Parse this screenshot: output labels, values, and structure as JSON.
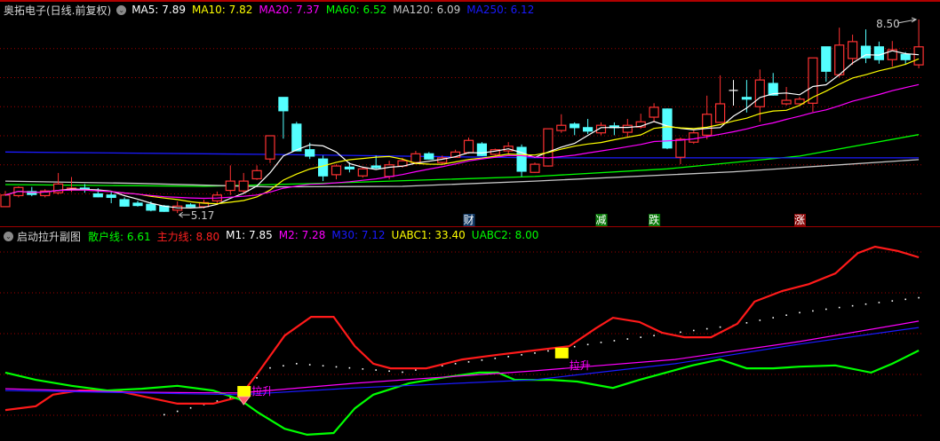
{
  "main_header": {
    "title": "奥拓电子(日线.前复权)",
    "items": [
      {
        "label": "MA5: ",
        "value": "7.89",
        "color": "#ffffff"
      },
      {
        "label": "MA10: ",
        "value": "7.82",
        "color": "#ffff00"
      },
      {
        "label": "MA20: ",
        "value": "7.37",
        "color": "#ff00ff"
      },
      {
        "label": "MA60: ",
        "value": "6.52",
        "color": "#00ff00"
      },
      {
        "label": "MA120: ",
        "value": "6.09",
        "color": "#c8c8c8"
      },
      {
        "label": "MA250: ",
        "value": "6.12",
        "color": "#1a1aff"
      }
    ]
  },
  "sub_header": {
    "title": "启动拉升副图",
    "items": [
      {
        "label": "散户线: ",
        "value": "6.61",
        "color": "#00ff00"
      },
      {
        "label": "主力线: ",
        "value": "8.80",
        "color": "#ff2020"
      },
      {
        "label": "M1: ",
        "value": "7.85",
        "color": "#ffffff"
      },
      {
        "label": "M2: ",
        "value": "7.28",
        "color": "#ff00ff"
      },
      {
        "label": "M30: ",
        "value": "7.12",
        "color": "#1a1aff"
      },
      {
        "label": "UABC1: ",
        "value": "33.40",
        "color": "#ffff00"
      },
      {
        "label": "UABC2: ",
        "value": "8.00",
        "color": "#00ff00"
      }
    ]
  },
  "colors": {
    "up": "#ff3232",
    "down": "#54ffff",
    "grid": "#a00000",
    "doji": "#ffffff"
  },
  "chart_data": [
    {
      "type": "candlestick",
      "title": "奥拓电子(日线.前复权)",
      "high_label": "8.50",
      "low_label": "5.17",
      "ohlc": [
        [
          5.28,
          5.55,
          5.28,
          5.48
        ],
        [
          5.47,
          5.63,
          5.44,
          5.61
        ],
        [
          5.54,
          5.62,
          5.46,
          5.49
        ],
        [
          5.47,
          5.58,
          5.44,
          5.55
        ],
        [
          5.52,
          5.86,
          5.49,
          5.67
        ],
        [
          5.58,
          5.79,
          5.53,
          5.6
        ],
        [
          5.6,
          5.67,
          5.52,
          5.57
        ],
        [
          5.5,
          5.6,
          5.44,
          5.45
        ],
        [
          5.48,
          5.54,
          5.34,
          5.44
        ],
        [
          5.4,
          5.44,
          5.28,
          5.29
        ],
        [
          5.34,
          5.38,
          5.28,
          5.3
        ],
        [
          5.32,
          5.37,
          5.2,
          5.22
        ],
        [
          5.29,
          5.31,
          5.19,
          5.2
        ],
        [
          5.22,
          5.37,
          5.17,
          5.29
        ],
        [
          5.31,
          5.34,
          5.27,
          5.28
        ],
        [
          5.28,
          5.4,
          5.25,
          5.35
        ],
        [
          5.38,
          5.54,
          5.34,
          5.48
        ],
        [
          5.56,
          5.99,
          5.48,
          5.72
        ],
        [
          5.55,
          5.86,
          5.52,
          5.72
        ],
        [
          5.76,
          5.99,
          5.74,
          5.9
        ],
        [
          6.1,
          6.5,
          6.03,
          6.5
        ],
        [
          7.16,
          7.16,
          6.45,
          6.93
        ],
        [
          6.7,
          6.74,
          6.24,
          6.24
        ],
        [
          6.26,
          6.38,
          6.1,
          6.15
        ],
        [
          6.1,
          6.16,
          5.72,
          5.81
        ],
        [
          5.83,
          6.01,
          5.75,
          5.98
        ],
        [
          5.96,
          6.04,
          5.87,
          5.93
        ],
        [
          5.81,
          5.96,
          5.78,
          5.93
        ],
        [
          5.98,
          6.16,
          5.93,
          5.95
        ],
        [
          5.8,
          6.07,
          5.75,
          6.0
        ],
        [
          5.98,
          6.12,
          5.95,
          6.07
        ],
        [
          6.04,
          6.24,
          6.01,
          6.19
        ],
        [
          6.19,
          6.22,
          6.09,
          6.1
        ],
        [
          6.04,
          6.16,
          6.01,
          6.12
        ],
        [
          6.13,
          6.26,
          6.12,
          6.22
        ],
        [
          6.21,
          6.47,
          6.19,
          6.42
        ],
        [
          6.36,
          6.39,
          6.15,
          6.16
        ],
        [
          6.18,
          6.28,
          6.16,
          6.26
        ],
        [
          6.24,
          6.39,
          6.19,
          6.32
        ],
        [
          6.3,
          6.35,
          5.8,
          5.89
        ],
        [
          5.87,
          6.04,
          5.86,
          6.01
        ],
        [
          5.98,
          6.62,
          5.97,
          6.62
        ],
        [
          6.59,
          6.87,
          6.55,
          6.68
        ],
        [
          6.7,
          6.73,
          6.51,
          6.64
        ],
        [
          6.64,
          6.79,
          6.53,
          6.58
        ],
        [
          6.55,
          6.73,
          6.51,
          6.68
        ],
        [
          6.67,
          6.73,
          6.51,
          6.64
        ],
        [
          6.56,
          6.79,
          6.47,
          6.68
        ],
        [
          6.65,
          6.88,
          6.62,
          6.74
        ],
        [
          6.82,
          7.06,
          6.73,
          6.99
        ],
        [
          6.96,
          6.97,
          6.27,
          6.29
        ],
        [
          6.13,
          6.47,
          6.01,
          6.44
        ],
        [
          6.39,
          6.59,
          6.36,
          6.55
        ],
        [
          6.51,
          7.19,
          6.44,
          6.87
        ],
        [
          6.73,
          7.54,
          6.73,
          7.05
        ],
        [
          7.28,
          7.46,
          7.02,
          7.28
        ],
        [
          7.16,
          7.46,
          6.9,
          7.13
        ],
        [
          7.0,
          7.64,
          6.74,
          7.46
        ],
        [
          7.4,
          7.58,
          7.19,
          7.2
        ],
        [
          7.05,
          7.34,
          7.02,
          7.11
        ],
        [
          7.05,
          7.17,
          7.05,
          7.13
        ],
        [
          7.06,
          7.84,
          6.91,
          7.84
        ],
        [
          8.03,
          8.03,
          7.43,
          7.61
        ],
        [
          7.55,
          8.36,
          7.51,
          8.06
        ],
        [
          7.83,
          8.24,
          7.72,
          8.12
        ],
        [
          8.04,
          8.33,
          7.75,
          7.84
        ],
        [
          8.03,
          8.12,
          7.74,
          7.81
        ],
        [
          7.81,
          8.13,
          7.69,
          7.98
        ],
        [
          7.9,
          7.94,
          7.72,
          7.81
        ],
        [
          7.72,
          8.5,
          7.66,
          8.03
        ]
      ],
      "ma_computed": [
        {
          "name": "MA5",
          "period": 5
        },
        {
          "name": "MA10",
          "period": 10
        },
        {
          "name": "MA20",
          "period": 20
        }
      ],
      "ma_series": [
        {
          "name": "MA60",
          "points": [
            [
              0,
              5.66
            ],
            [
              15,
              5.63
            ],
            [
              25,
              5.69
            ],
            [
              40,
              5.8
            ],
            [
              50,
              5.93
            ],
            [
              60,
              6.15
            ],
            [
              69,
              6.52
            ]
          ]
        },
        {
          "name": "MA120",
          "points": [
            [
              0,
              5.72
            ],
            [
              10,
              5.68
            ],
            [
              20,
              5.62
            ],
            [
              30,
              5.63
            ],
            [
              40,
              5.72
            ],
            [
              55,
              5.88
            ],
            [
              69,
              6.09
            ]
          ]
        },
        {
          "name": "MA250",
          "points": [
            [
              0,
              6.22
            ],
            [
              20,
              6.18
            ],
            [
              40,
              6.12
            ],
            [
              69,
              6.12
            ]
          ]
        }
      ],
      "signals": [
        {
          "index": 35,
          "text": "财",
          "bg": "#123a66"
        },
        {
          "index": 45,
          "text": "减",
          "bg": "#0a7a0a"
        },
        {
          "index": 49,
          "text": "跌",
          "bg": "#0a7a0a"
        },
        {
          "index": 60,
          "text": "涨",
          "bg": "#8a0a0a"
        }
      ],
      "gridlines": [
        8.0,
        7.5,
        7.0,
        6.5,
        6.0,
        5.5
      ]
    },
    {
      "type": "line",
      "title": "启动拉升副图",
      "series": [
        {
          "name": "主力线",
          "color": "#ff1a1a",
          "points": [
            [
              0,
              5.21
            ],
            [
              2.3,
              5.3
            ],
            [
              3.6,
              5.57
            ],
            [
              5.6,
              5.67
            ],
            [
              8.3,
              5.67
            ],
            [
              13,
              5.36
            ],
            [
              15.7,
              5.36
            ],
            [
              17.7,
              5.52
            ],
            [
              19.1,
              6.09
            ],
            [
              21.1,
              6.96
            ],
            [
              23.1,
              7.4
            ],
            [
              24.8,
              7.4
            ],
            [
              26.4,
              6.71
            ],
            [
              27.8,
              6.3
            ],
            [
              29.1,
              6.19
            ],
            [
              31.8,
              6.19
            ],
            [
              34.5,
              6.4
            ],
            [
              37.2,
              6.51
            ],
            [
              39.9,
              6.61
            ],
            [
              42.6,
              6.71
            ],
            [
              44.6,
              7.13
            ],
            [
              45.9,
              7.38
            ],
            [
              47.9,
              7.28
            ],
            [
              49.6,
              7.03
            ],
            [
              51.3,
              6.92
            ],
            [
              53.3,
              6.92
            ],
            [
              55.3,
              7.24
            ],
            [
              56.6,
              7.76
            ],
            [
              58.7,
              8.01
            ],
            [
              60.7,
              8.17
            ],
            [
              62.7,
              8.42
            ],
            [
              64.4,
              8.9
            ],
            [
              65.7,
              9.05
            ],
            [
              67.4,
              8.95
            ],
            [
              69,
              8.8
            ]
          ]
        },
        {
          "name": "散户线",
          "color": "#00ff00",
          "points": [
            [
              0,
              6.09
            ],
            [
              2.3,
              5.92
            ],
            [
              5,
              5.78
            ],
            [
              7.7,
              5.67
            ],
            [
              10.3,
              5.71
            ],
            [
              13,
              5.78
            ],
            [
              15.7,
              5.67
            ],
            [
              17.7,
              5.46
            ],
            [
              19.1,
              5.15
            ],
            [
              21.1,
              4.77
            ],
            [
              22.8,
              4.63
            ],
            [
              24.8,
              4.67
            ],
            [
              26.4,
              5.25
            ],
            [
              27.8,
              5.57
            ],
            [
              30.5,
              5.84
            ],
            [
              33.2,
              5.98
            ],
            [
              35.8,
              6.09
            ],
            [
              37.2,
              6.09
            ],
            [
              38.5,
              5.92
            ],
            [
              41.2,
              5.92
            ],
            [
              43.2,
              5.88
            ],
            [
              45.9,
              5.73
            ],
            [
              47.9,
              5.92
            ],
            [
              49.9,
              6.09
            ],
            [
              51.9,
              6.26
            ],
            [
              54,
              6.4
            ],
            [
              56,
              6.19
            ],
            [
              58,
              6.19
            ],
            [
              60,
              6.23
            ],
            [
              62.7,
              6.26
            ],
            [
              65.4,
              6.09
            ],
            [
              67,
              6.3
            ],
            [
              69,
              6.61
            ]
          ]
        },
        {
          "name": "M2",
          "color": "#ff00ff",
          "points": [
            [
              0,
              5.71
            ],
            [
              9.7,
              5.63
            ],
            [
              17.7,
              5.61
            ],
            [
              26.4,
              5.84
            ],
            [
              39.9,
              6.13
            ],
            [
              50.6,
              6.4
            ],
            [
              60,
              6.82
            ],
            [
              69,
              7.3
            ]
          ]
        },
        {
          "name": "M30",
          "color": "#1a1aff",
          "points": [
            [
              0,
              5.67
            ],
            [
              17.7,
              5.57
            ],
            [
              26.4,
              5.73
            ],
            [
              39.9,
              5.92
            ],
            [
              50.6,
              6.3
            ],
            [
              60,
              6.76
            ],
            [
              69,
              7.15
            ]
          ]
        }
      ],
      "dots": {
        "name": "M1",
        "color": "#ffffff",
        "points": [
          [
            12,
            5.1
          ],
          [
            17,
            5.5
          ],
          [
            20,
            6.2
          ],
          [
            22,
            6.3
          ],
          [
            26,
            6.2
          ],
          [
            30,
            6.1
          ],
          [
            34,
            6.3
          ],
          [
            40,
            6.55
          ],
          [
            45,
            6.8
          ],
          [
            50,
            7.0
          ],
          [
            55,
            7.2
          ],
          [
            60,
            7.5
          ],
          [
            65,
            7.7
          ],
          [
            69,
            7.85
          ]
        ]
      },
      "signals": [
        {
          "index": 18,
          "text": "拉升",
          "value": 5.65
        },
        {
          "index": 42,
          "text": "拉升",
          "value": 6.55
        }
      ]
    }
  ]
}
